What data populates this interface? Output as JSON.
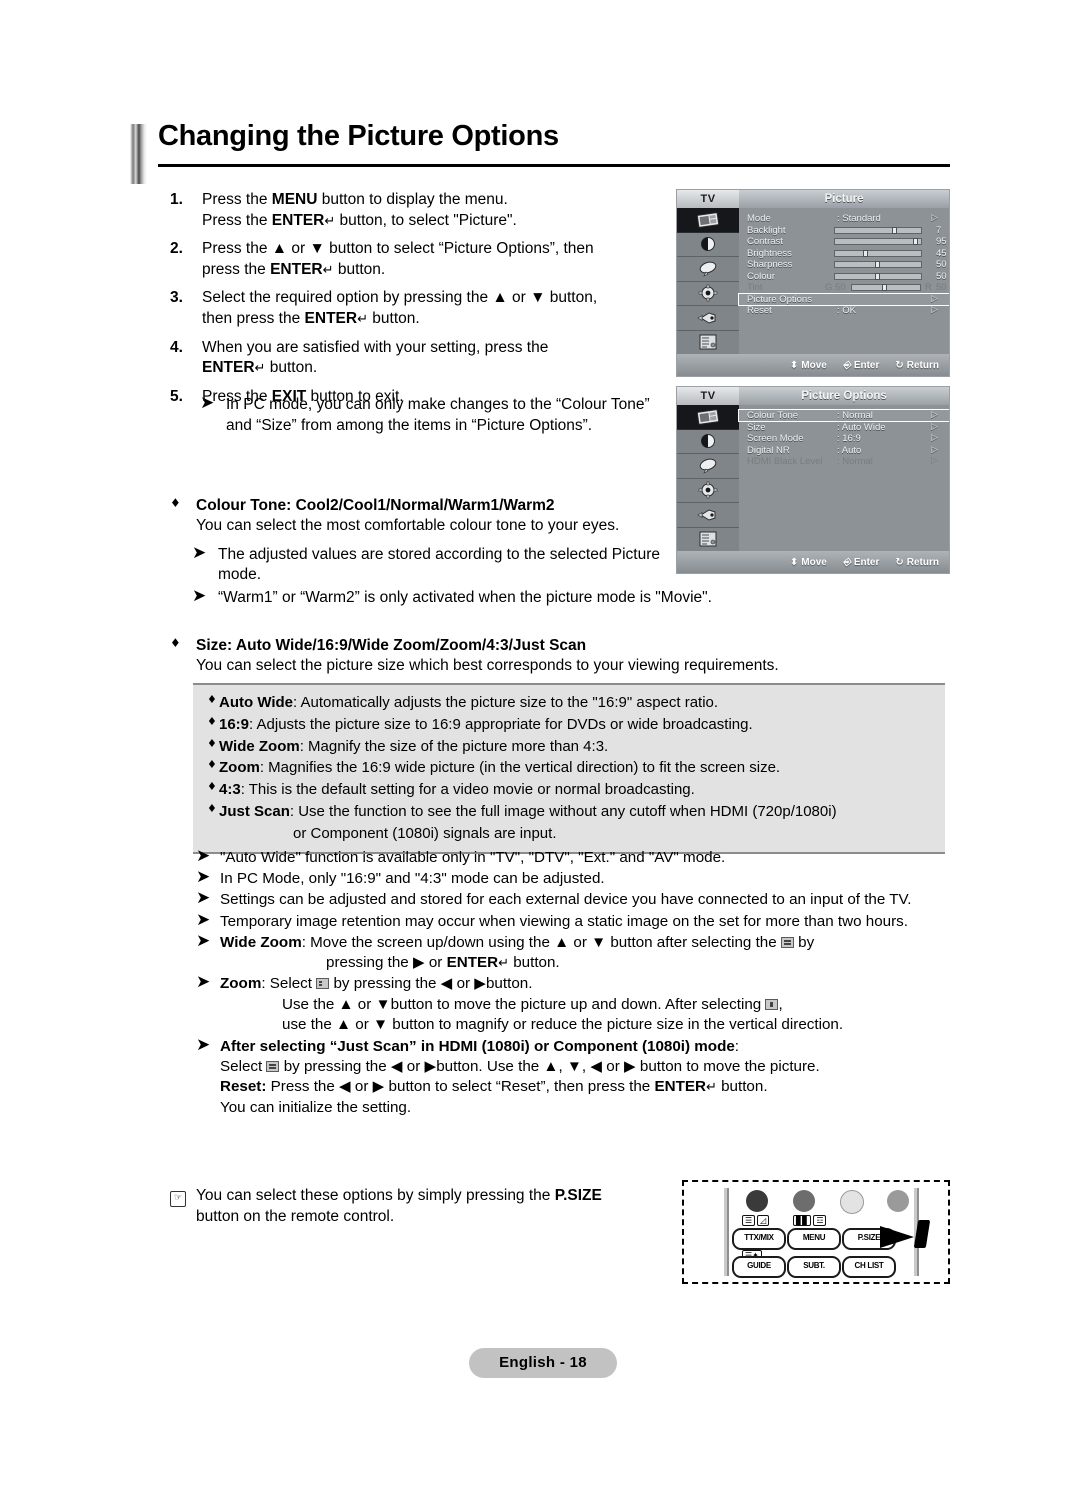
{
  "page": {
    "title": "Changing the Picture Options",
    "footer_label": "English - 18"
  },
  "steps": [
    {
      "num": "1.",
      "lines": [
        "Press the MENU button to display the menu.",
        "Press the ENTER↵ button, to select \"Picture\"."
      ]
    },
    {
      "num": "2.",
      "lines": [
        "Press the ▲ or ▼ button to select “Picture Options”, then",
        "press the ENTER↵ button."
      ]
    },
    {
      "num": "3.",
      "lines": [
        "Select the required option by pressing the ▲ or ▼ button,",
        "then press the ENTER↵ button."
      ]
    },
    {
      "num": "4.",
      "lines": [
        "When you are satisfied with your setting, press the",
        "ENTER↵ button."
      ]
    },
    {
      "num": "5.",
      "lines": [
        "Press the EXIT button to exit."
      ]
    }
  ],
  "pc_note": "In PC mode, you can only make changes to the “Colour Tone” and “Size” from among the items in “Picture Options”.",
  "osd_picture": {
    "tv_label": "TV",
    "title": "Picture",
    "rows": [
      {
        "label": "Mode",
        "value": ": Standard",
        "arrow": "▷"
      },
      {
        "label": "Backlight",
        "number": "7",
        "slider": 72
      },
      {
        "label": "Contrast",
        "number": "95",
        "slider": 95
      },
      {
        "label": "Brightness",
        "number": "45",
        "slider": 36
      },
      {
        "label": "Sharpness",
        "number": "50",
        "slider": 50
      },
      {
        "label": "Colour",
        "number": "50",
        "slider": 50
      },
      {
        "label": "Tint",
        "left_tag": "G  50",
        "right_tag": "R",
        "number": "50",
        "slider": 50,
        "dim": true
      },
      {
        "label": "Picture Options",
        "arrow": "▷",
        "selected": true
      },
      {
        "label": "Reset",
        "value": ": OK",
        "arrow": "▷"
      }
    ],
    "footer": {
      "move": "Move",
      "enter": "Enter",
      "return": "Return"
    }
  },
  "osd_options": {
    "tv_label": "TV",
    "title": "Picture Options",
    "rows": [
      {
        "label": "Colour Tone",
        "value": ": Normal",
        "arrow": "▷",
        "selected": true
      },
      {
        "label": "Size",
        "value": ": Auto Wide",
        "arrow": "▷"
      },
      {
        "label": "Screen Mode",
        "value": ": 16:9",
        "arrow": "▷"
      },
      {
        "label": "Digital NR",
        "value": ": Auto",
        "arrow": "▷"
      },
      {
        "label": "HDMI Black Level",
        "value": ": Normal",
        "arrow": "▷",
        "dim": true
      }
    ],
    "footer": {
      "move": "Move",
      "enter": "Enter",
      "return": "Return"
    }
  },
  "colour_tone": {
    "heading": "Colour Tone: Cool2/Cool1/Normal/Warm1/Warm2",
    "sub": "You can select the most comfortable colour tone to your eyes.",
    "note1": "The adjusted values are stored according to the selected Picture mode.",
    "note2": "“Warm1” or “Warm2” is only activated when the picture mode is \"Movie\"."
  },
  "size": {
    "heading": "Size: Auto Wide/16:9/Wide Zoom/Zoom/4:3/Just Scan",
    "sub": "You can select the picture size which best corresponds to your viewing requirements.",
    "items": [
      {
        "term": "Auto Wide",
        "desc": ": Automatically adjusts the picture size to the \"16:9\" aspect ratio."
      },
      {
        "term": "16:9",
        "desc": ": Adjusts the picture size to 16:9 appropriate for DVDs or wide broadcasting."
      },
      {
        "term": "Wide Zoom",
        "desc": ": Magnify the size of the picture more than 4:3."
      },
      {
        "term": "Zoom",
        "desc": ": Magnifies the 16:9 wide picture (in the vertical direction) to fit the screen size."
      },
      {
        "term": "4:3",
        "desc": ": This is the default setting for a video movie or normal broadcasting."
      },
      {
        "term": "Just Scan",
        "desc": ": Use the function to see the full image without any cutoff when HDMI (720p/1080i)"
      }
    ],
    "just_scan_cont": "or Component (1080i) signals are input."
  },
  "notes": {
    "n1": "\"Auto Wide\" function is available only in \"TV\", \"DTV\", \"Ext.\" and \"AV\" mode.",
    "n2": "In PC Mode, only \"16:9\" and \"4:3\" mode can be adjusted.",
    "n3": "Settings can be adjusted and stored for each external device you have connected to an input of the TV.",
    "n4": "Temporary image retention may occur when viewing a static image on the set for more than two hours.",
    "n5_term": "Wide Zoom",
    "n5_a": ": Move the screen up/down using the ▲ or ▼ button after selecting the",
    "n5_b": "by",
    "n5_c": "pressing the ▶ or ENTER↵ button.",
    "n6_term": "Zoom",
    "n6_a": ": Select",
    "n6_b": "by pressing the ◀ or ▶button.",
    "n6_c1": "Use the ▲ or ▼button to move the picture up and down. After selecting",
    "n6_c2": ",",
    "n6_d": "use the ▲ or ▼ button to magnify or reduce the picture size in the vertical direction.",
    "n7_head": "After selecting “Just Scan” in HDMI (1080i) or Component (1080i) mode",
    "n7_colon": ":",
    "n7_a": "Select",
    "n7_b": "by pressing the ◀ or ▶button. Use the ▲, ▼, ◀ or ▶ button to move the picture.",
    "n7_reset_term": "Reset:",
    "n7_reset": "Press the ◀ or ▶ button to select “Reset”, then press the ENTER↵ button.",
    "n7_init": "You can initialize the setting."
  },
  "psize_note": {
    "line1_a": "You can select these options by simply pressing the",
    "line1_b": "P.SIZE",
    "line2": "button on the remote control."
  },
  "remote": {
    "buttons": [
      "TTX/MIX",
      "MENU",
      "P.SIZE",
      "GUIDE",
      "SUBT.",
      "CH LIST"
    ],
    "dot_colors": [
      "#3a3a3a",
      "#6d6d6d",
      "#e3e3e3",
      "#9a9a9a"
    ]
  }
}
